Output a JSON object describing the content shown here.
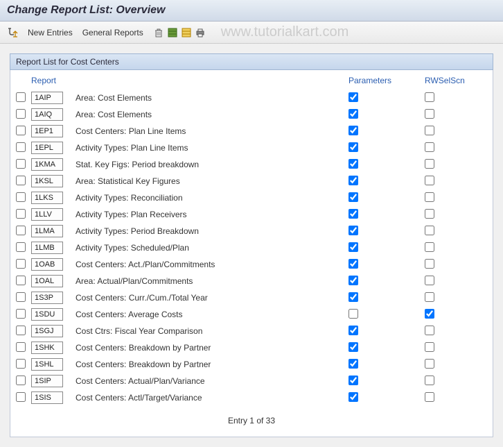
{
  "title": "Change Report List: Overview",
  "toolbar": {
    "new_entries": "New Entries",
    "general_reports": "General Reports"
  },
  "watermark": "www.tutorialkart.com",
  "panel": {
    "title": "Report List for Cost Centers",
    "columns": {
      "report": "Report",
      "parameters": "Parameters",
      "rwselscn": "RWSelScn"
    }
  },
  "rows": [
    {
      "code": "1AIP",
      "desc": "Area: Cost Elements",
      "param": true,
      "rw": false
    },
    {
      "code": "1AIQ",
      "desc": "Area: Cost Elements",
      "param": true,
      "rw": false
    },
    {
      "code": "1EP1",
      "desc": "Cost Centers: Plan Line Items",
      "param": true,
      "rw": false
    },
    {
      "code": "1EPL",
      "desc": "Activity Types: Plan Line Items",
      "param": true,
      "rw": false
    },
    {
      "code": "1KMA",
      "desc": "Stat. Key Figs: Period breakdown",
      "param": true,
      "rw": false
    },
    {
      "code": "1KSL",
      "desc": "Area: Statistical Key Figures",
      "param": true,
      "rw": false
    },
    {
      "code": "1LKS",
      "desc": "Activity Types: Reconciliation",
      "param": true,
      "rw": false
    },
    {
      "code": "1LLV",
      "desc": "Activity Types: Plan Receivers",
      "param": true,
      "rw": false
    },
    {
      "code": "1LMA",
      "desc": "Activity Types: Period Breakdown",
      "param": true,
      "rw": false
    },
    {
      "code": "1LMB",
      "desc": "Activity Types: Scheduled/Plan",
      "param": true,
      "rw": false
    },
    {
      "code": "1OAB",
      "desc": "Cost Centers: Act./Plan/Commitments",
      "param": true,
      "rw": false
    },
    {
      "code": "1OAL",
      "desc": "Area: Actual/Plan/Commitments",
      "param": true,
      "rw": false
    },
    {
      "code": "1S3P",
      "desc": "Cost Centers: Curr./Cum./Total Year",
      "param": true,
      "rw": false
    },
    {
      "code": "1SDU",
      "desc": "Cost Centers: Average Costs",
      "param": false,
      "rw": true
    },
    {
      "code": "1SGJ",
      "desc": "Cost Ctrs: Fiscal Year Comparison",
      "param": true,
      "rw": false
    },
    {
      "code": "1SHK",
      "desc": "Cost Centers: Breakdown by Partner",
      "param": true,
      "rw": false
    },
    {
      "code": "1SHL",
      "desc": "Cost Centers: Breakdown by Partner",
      "param": true,
      "rw": false
    },
    {
      "code": "1SIP",
      "desc": "Cost Centers: Actual/Plan/Variance",
      "param": true,
      "rw": false
    },
    {
      "code": "1SIS",
      "desc": "Cost Centers: Actl/Target/Variance",
      "param": true,
      "rw": false
    }
  ],
  "footer": "Entry 1 of 33"
}
